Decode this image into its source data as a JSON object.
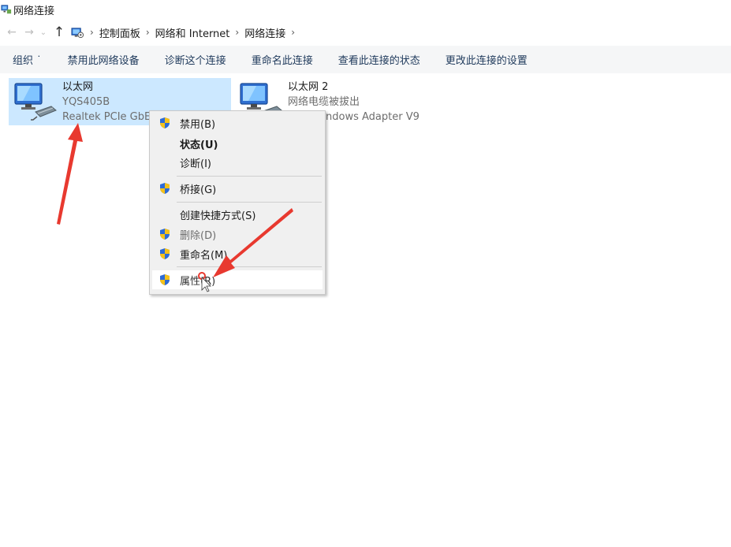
{
  "window": {
    "title": "网络连接",
    "title_icon": "network-connections-icon"
  },
  "nav": {
    "back_icon": "back-arrow-icon",
    "forward_icon": "forward-arrow-icon",
    "recent_icon": "chevron-down-icon",
    "up_icon": "up-arrow-icon",
    "breadcrumbs": [
      "控制面板",
      "网络和 Internet",
      "网络连接"
    ]
  },
  "commands": [
    "组织",
    "禁用此网络设备",
    "诊断这个连接",
    "重命名此连接",
    "查看此连接的状态",
    "更改此连接的设置"
  ],
  "adapters": [
    {
      "name": "以太网",
      "line2": "YQS405B",
      "line3": "Realtek PCIe GbE",
      "selected": true
    },
    {
      "name": "以太网 2",
      "line2": "网络电缆被拔出",
      "line3": "ndows Adapter V9",
      "selected": false
    }
  ],
  "context_menu": [
    {
      "label": "禁用(B)",
      "shield": true,
      "style": "normal"
    },
    {
      "label": "状态(U)",
      "shield": false,
      "style": "bold"
    },
    {
      "label": "诊断(I)",
      "shield": false,
      "style": "normal"
    },
    {
      "label": "桥接(G)",
      "shield": true,
      "style": "normal"
    },
    {
      "label": "创建快捷方式(S)",
      "shield": false,
      "style": "normal"
    },
    {
      "label": "删除(D)",
      "shield": true,
      "style": "disabled"
    },
    {
      "label": "重命名(M)",
      "shield": true,
      "style": "normal"
    },
    {
      "label": "属性(R)",
      "shield": true,
      "style": "hover"
    }
  ],
  "colors": {
    "selection": "#cce8ff",
    "command_text": "#1e395b",
    "annotation_arrow": "#e8392f",
    "shield_blue": "#2d6bd6",
    "shield_yellow": "#f5c21a"
  }
}
